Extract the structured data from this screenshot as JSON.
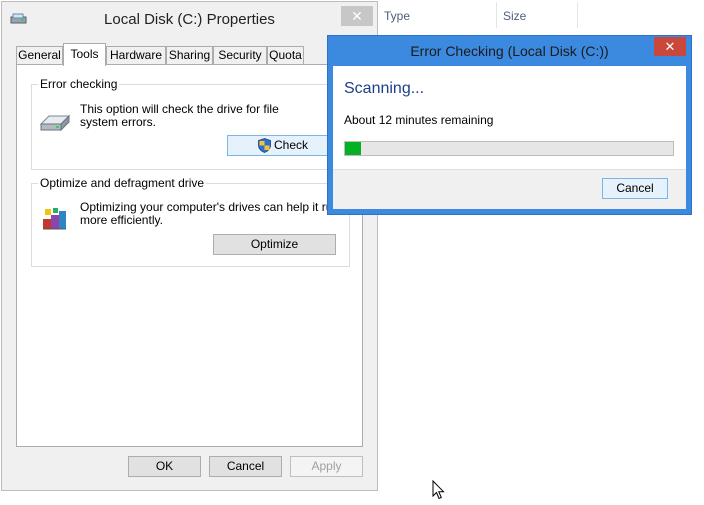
{
  "explorer_columns": [
    "Type",
    "Size"
  ],
  "properties": {
    "title": "Local Disk (C:) Properties",
    "close_glyph": "✕",
    "tabs": [
      "General",
      "Tools",
      "Hardware",
      "Sharing",
      "Security",
      "Quota"
    ],
    "active_tab": "Tools",
    "error_checking": {
      "group_label": "Error checking",
      "description_line1": "This option will check the drive for file",
      "description_line2": "system errors.",
      "check_button": "Check",
      "icon": "hard-drive-icon",
      "button_icon": "uac-shield-icon"
    },
    "optimize": {
      "group_label": "Optimize and defragment drive",
      "description_line1": "Optimizing your computer's drives can help it run",
      "description_line2": "more efficiently.",
      "optimize_button": "Optimize",
      "icon": "defrag-icon"
    },
    "footer": {
      "ok": "OK",
      "cancel": "Cancel",
      "apply": "Apply"
    }
  },
  "error_dialog": {
    "title": "Error Checking (Local Disk (C:))",
    "close_glyph": "✕",
    "status": "Scanning...",
    "remaining": "About 12 minutes remaining",
    "progress": 0.05,
    "cancel": "Cancel"
  },
  "colors": {
    "dialog_frame": "#3c8ae0",
    "close_button": "#c9473b",
    "progress_fill": "#06b025",
    "scanning_text": "#1e3f8a"
  }
}
